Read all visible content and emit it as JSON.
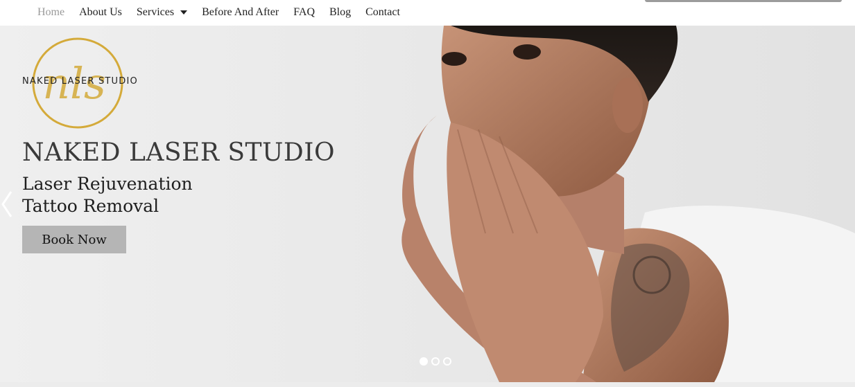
{
  "nav": {
    "items": [
      {
        "label": "Home",
        "active": true
      },
      {
        "label": "About Us"
      },
      {
        "label": "Services",
        "has_dropdown": true
      },
      {
        "label": "Before And After"
      },
      {
        "label": "FAQ"
      },
      {
        "label": "Blog"
      },
      {
        "label": "Contact"
      }
    ]
  },
  "logo": {
    "monogram": "nls",
    "text": "NAKED LASER STUDIO",
    "ring_color": "#d4aa3a"
  },
  "hero": {
    "title": "NAKED LASER STUDIO",
    "subtitle_line1": "Laser Rejuvenation",
    "subtitle_line2": "Tattoo Removal",
    "cta_label": "Book Now",
    "slides": {
      "count": 3,
      "active": 1
    }
  },
  "colors": {
    "nav_active": "#9a9a9a",
    "button_bg": "#b5b5b5",
    "title": "#3a3a3a"
  }
}
